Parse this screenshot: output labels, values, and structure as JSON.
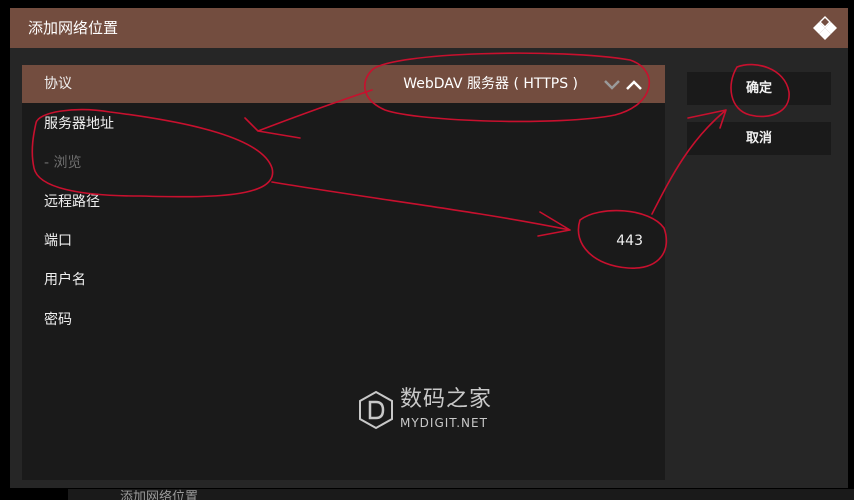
{
  "dialog": {
    "title": "添加网络位置"
  },
  "settings": {
    "protocol_label": "协议",
    "protocol_value": "WebDAV 服务器 ( HTTPS )",
    "server_label": "服务器地址",
    "browse_label": "- 浏览",
    "remote_path_label": "远程路径",
    "port_label": "端口",
    "port_value": "443",
    "username_label": "用户名",
    "password_label": "密码"
  },
  "buttons": {
    "ok_label": "确定",
    "cancel_label": "取消"
  },
  "watermark": {
    "name_cn": "数码之家",
    "name_en": "MYDIGIT.NET"
  },
  "background_window": {
    "title": "添加网络位置"
  },
  "colors": {
    "accent": "#734d3f",
    "panel": "#1a1a1a",
    "dialog_bg": "#262626",
    "annotation": "#c8102e"
  },
  "icons": {
    "app_logo": "kodi-logo-icon",
    "spinner_down": "chevron-down-icon",
    "spinner_up": "chevron-up-icon",
    "watermark": "mydigit-logo-icon"
  }
}
